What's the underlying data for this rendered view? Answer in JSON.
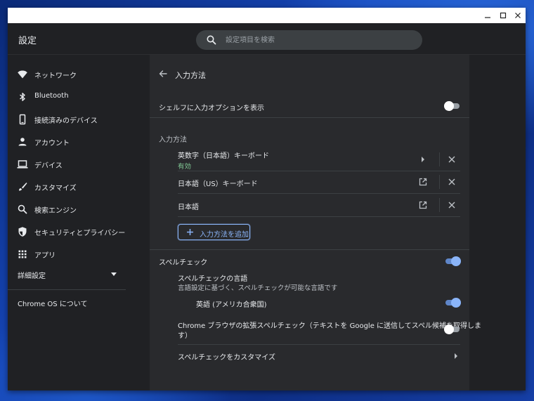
{
  "window": {
    "controls": {
      "minimize": "minimize-icon",
      "maximize": "maximize-icon",
      "close": "close-icon"
    }
  },
  "header": {
    "title": "設定",
    "search": {
      "placeholder": "設定項目を検索",
      "icon": "search-icon"
    }
  },
  "sidebar": {
    "items": [
      {
        "label": "ネットワーク",
        "icon": "wifi-icon"
      },
      {
        "label": "Bluetooth",
        "icon": "bluetooth-icon"
      },
      {
        "label": "接続済みのデバイス",
        "icon": "phone-icon"
      },
      {
        "label": "アカウント",
        "icon": "person-icon"
      },
      {
        "label": "デバイス",
        "icon": "laptop-icon"
      },
      {
        "label": "カスタマイズ",
        "icon": "brush-icon"
      },
      {
        "label": "検索エンジン",
        "icon": "search-icon"
      },
      {
        "label": "セキュリティとプライバシー",
        "icon": "shield-icon"
      },
      {
        "label": "アプリ",
        "icon": "apps-grid-icon"
      }
    ],
    "advanced": {
      "label": "詳細設定",
      "expanded": false
    },
    "about": {
      "label": "Chrome OS について"
    }
  },
  "page": {
    "title": "入力方法",
    "shelf_option": {
      "label": "シェルフに入力オプションを表示",
      "enabled": false
    },
    "input_methods": {
      "section_label": "入力方法",
      "items": [
        {
          "name": "英数字（日本語）キーボード",
          "status": "有効",
          "action_icon": "chevron-right-icon"
        },
        {
          "name": "日本語（US）キーボード",
          "action_icon": "open-in-new-icon"
        },
        {
          "name": "日本語",
          "action_icon": "open-in-new-icon"
        }
      ],
      "add_button": "入力方法を追加"
    },
    "spellcheck": {
      "label": "スペルチェック",
      "enabled": true,
      "languages_title": "スペルチェックの言語",
      "languages_desc": "言語設定に基づく、スペルチェックが可能な言語です",
      "language_item": {
        "label": "英語 (アメリカ合衆国)",
        "enabled": true
      },
      "enhanced": {
        "line1": "Chrome ブラウザの拡張スペルチェック（テキストを Google に送信してスペル候補を取得しま",
        "line2": "す）",
        "enabled": false
      },
      "customize": {
        "label": "スペルチェックをカスタマイズ"
      }
    }
  },
  "colors": {
    "background": "#202124",
    "panel": "#292a2d",
    "accent": "#8ab4f8",
    "status_ok": "#81c995"
  }
}
